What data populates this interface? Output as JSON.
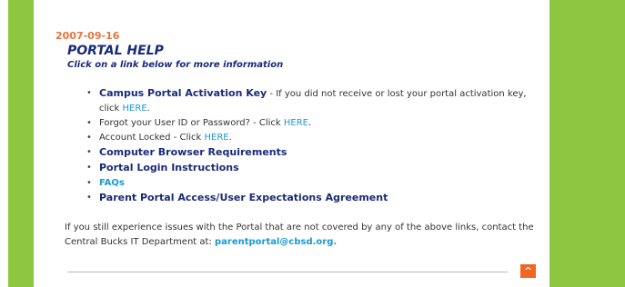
{
  "date": "2007-09-16",
  "title": "PORTAL HELP",
  "subtitle": "Click on a link below for more information",
  "items": [
    {
      "bold": "Campus Portal Activation Key",
      "text": " - If you did not receive or lost your portal activation key, click ",
      "link": "HERE",
      "after": "."
    },
    {
      "text": "Forgot your User ID or Password? -  Click ",
      "link": "HERE",
      "after": "."
    },
    {
      "text": "Account Locked - Click ",
      "link": "HERE",
      "after": "."
    },
    {
      "bold": "Computer Browser Requirements"
    },
    {
      "bold": "Portal Login Instructions"
    },
    {
      "link": "FAQs"
    },
    {
      "bold": "Parent Portal Access/User Expectations Agreement"
    }
  ],
  "footer": {
    "text": "If you still experience issues with the Portal that are not covered by any of the above links, contact the Central Bucks IT Department at: ",
    "email": "parentportal@cbsd.org."
  },
  "back_to_top": "^",
  "colors": {
    "green_bar": "#8dc63f",
    "title": "#1a2a7a",
    "link": "#1a9ad6",
    "date": "#e8743b",
    "top_button": "#f26522"
  }
}
